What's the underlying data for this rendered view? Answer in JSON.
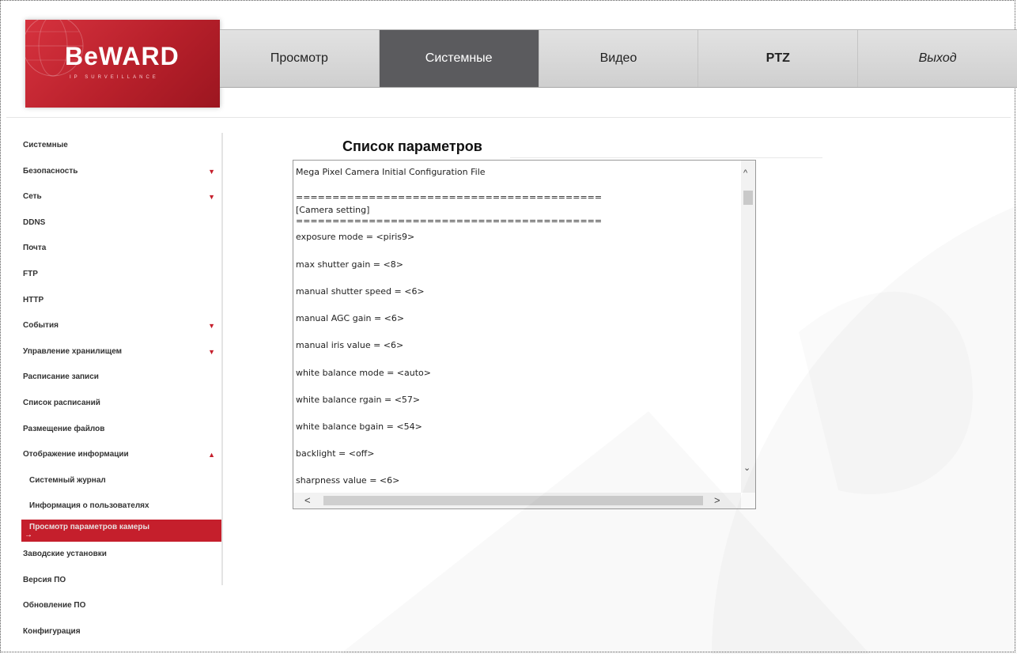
{
  "header": {
    "logo_text": "BeWARD",
    "logo_subtitle": "IP SURVEILLANCE",
    "nav": [
      {
        "label": "Просмотр"
      },
      {
        "label": "Системные"
      },
      {
        "label": "Видео"
      },
      {
        "label": "PTZ"
      },
      {
        "label": "Выход"
      }
    ]
  },
  "sidebar": {
    "items": [
      {
        "label": "Системные"
      },
      {
        "label": "Безопасность",
        "arrow": "▼"
      },
      {
        "label": "Сеть",
        "arrow": "▼"
      },
      {
        "label": "DDNS"
      },
      {
        "label": "Почта"
      },
      {
        "label": "FTP"
      },
      {
        "label": "HTTP"
      },
      {
        "label": "События",
        "arrow": "▼"
      },
      {
        "label": "Управление хранилищем",
        "arrow": "▼"
      },
      {
        "label": "Расписание записи"
      },
      {
        "label": "Список расписаний"
      },
      {
        "label": "Размещение файлов"
      },
      {
        "label": "Отображение информации",
        "arrow": "▲"
      },
      {
        "label": "Системный журнал"
      },
      {
        "label": "Информация о пользователях"
      },
      {
        "label": "Просмотр параметров камеры",
        "active_arrow": "→"
      },
      {
        "label": "Заводские установки"
      },
      {
        "label": "Версия ПО"
      },
      {
        "label": "Обновление ПО"
      },
      {
        "label": "Конфигурация"
      }
    ]
  },
  "main": {
    "title": "Список параметров",
    "lines": [
      "Mega Pixel Camera Initial Configuration File",
      "==========================================",
      "[Camera setting]",
      "==========================================",
      "exposure mode = <piris9>",
      "max shutter gain = <8>",
      "manual shutter speed = <6>",
      "manual AGC gain = <6>",
      "manual iris value = <6>",
      "white balance mode = <auto>",
      "white balance rgain = <57>",
      "white balance bgain = <54>",
      "backlight = <off>",
      "sharpness value = <6>"
    ],
    "scroll_up": "^",
    "scroll_down": "⌄",
    "scroll_left": "<",
    "scroll_right": ">"
  },
  "colors": {
    "brand_red": "#c51f2c",
    "nav_active": "#5b5b5e"
  }
}
